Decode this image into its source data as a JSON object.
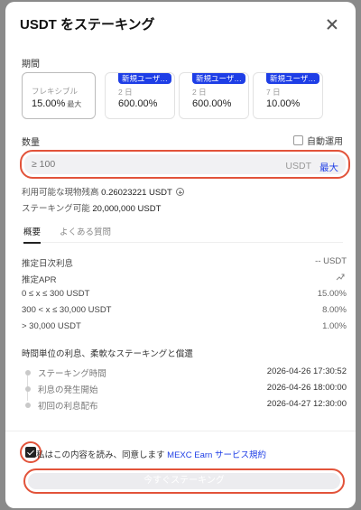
{
  "modal": {
    "title": "USDT をステーキング"
  },
  "period": {
    "label": "期間",
    "options": [
      {
        "name": "フレキシブル",
        "rate": "15.00%",
        "suffix": "最大"
      },
      {
        "badge": "新規ユーザ…",
        "duration": "2 日",
        "rate": "600.00%"
      },
      {
        "badge": "新規ユーザ…",
        "duration": "2 日",
        "rate": "600.00%"
      },
      {
        "badge": "新規ユーザ…",
        "duration": "7 日",
        "rate": "10.00%"
      }
    ]
  },
  "quantity": {
    "label": "数量",
    "auto_label": "自動運用",
    "placeholder": "≥ 100",
    "unit": "USDT",
    "max_label": "最大"
  },
  "balance": {
    "available_label": "利用可能な現物残高",
    "available_value": "0.26023221 USDT",
    "stakeable_label": "ステーキング可能",
    "stakeable_value": "20,000,000 USDT"
  },
  "tabs": [
    {
      "label": "概要",
      "active": true
    },
    {
      "label": "よくある質問",
      "active": false
    }
  ],
  "overview": {
    "daily_interest_label": "推定日次利息",
    "daily_interest_value": "-- USDT",
    "apr_label": "推定APR",
    "tiers": [
      {
        "range": "0 ≤ x ≤ 300 USDT",
        "rate": "15.00%"
      },
      {
        "range": "300 < x ≤ 30,000 USDT",
        "rate": "8.00%"
      },
      {
        "range": "> 30,000 USDT",
        "rate": "1.00%"
      }
    ]
  },
  "timeline": {
    "title": "時間単位の利息、柔軟なステーキングと償還",
    "items": [
      {
        "label": "ステーキング時間",
        "time": "2026-04-26 17:30:52"
      },
      {
        "label": "利息の発生開始",
        "time": "2026-04-26 18:00:00"
      },
      {
        "label": "初回の利息配布",
        "time": "2026-04-27 12:30:00"
      }
    ]
  },
  "agreement": {
    "text": "私はこの内容を読み、同意します",
    "link": "MEXC Earn サービス規約"
  },
  "stake_button": {
    "label": "今すぐステーキング"
  },
  "colors": {
    "accent": "#1e3ee6",
    "highlight": "#e2533a"
  }
}
